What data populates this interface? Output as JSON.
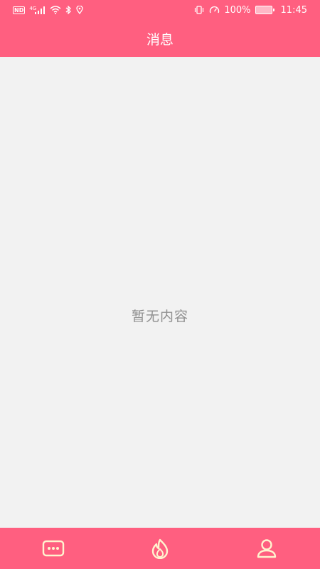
{
  "status_bar": {
    "network_badge": "ND",
    "signal_tag": "4G",
    "battery_percent": "100%",
    "time": "11:45",
    "icons": [
      "signal-icon",
      "wifi-icon",
      "bluetooth-icon",
      "location-icon",
      "vibrate-icon",
      "speed-icon",
      "battery-icon"
    ]
  },
  "header": {
    "title": "消息"
  },
  "content": {
    "empty_text": "暂无内容"
  },
  "tabs": [
    {
      "name": "messages",
      "icon": "chat-dots-icon"
    },
    {
      "name": "discover",
      "icon": "flame-icon"
    },
    {
      "name": "profile",
      "icon": "user-icon"
    }
  ],
  "colors": {
    "primary": "#ff5f80",
    "background": "#f2f2f2",
    "tab_icon": "#fff4cf",
    "empty_text": "#8f8f8f"
  }
}
